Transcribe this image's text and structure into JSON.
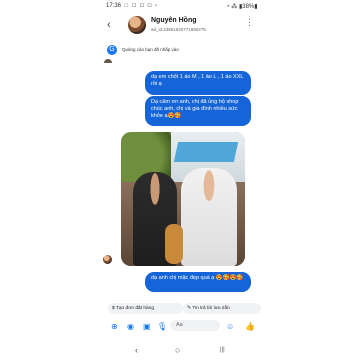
{
  "status_bar": {
    "time": "17:36",
    "icons": "☐ ⚀ ⚀ ⚀ •",
    "right": "◔ ⁂ ▮38%▮"
  },
  "header": {
    "back": "‹",
    "name": "Nguyên Hồng",
    "subtitle": "ad_id:238515407719902​75",
    "more": "⋮"
  },
  "banner": {
    "icon": "G",
    "text": "Quảng cáo bạn đã nhấp vào"
  },
  "messages": [
    {
      "text": "dạ em chốt 1 áo M , 1 áo L , 1 áo XXL rồi ạ"
    },
    {
      "text": "Dạ cảm ơn anh, chị đã ủng hộ shop chúc anh, chị và gia đình nhiều sức khỏe ạ😍🥰"
    },
    {
      "text": "dạ anh chị mặc đẹp quá ạ 😍🥰😍🥰"
    }
  ],
  "chips": [
    {
      "icon": "$",
      "label": "Tạo đơn đặt hàng"
    },
    {
      "icon": "✎",
      "label": "Tin trả lời lưu sẵn"
    }
  ],
  "composer": {
    "placeholder": "Aa",
    "icons": [
      "⊕",
      "◉",
      "▣",
      "🎙",
      "☺",
      "👍"
    ]
  },
  "nav": {
    "back": "‹",
    "home": "○",
    "recent": "|||"
  },
  "colors": {
    "accent": "#1877f2",
    "bubble": "#1565d8"
  }
}
